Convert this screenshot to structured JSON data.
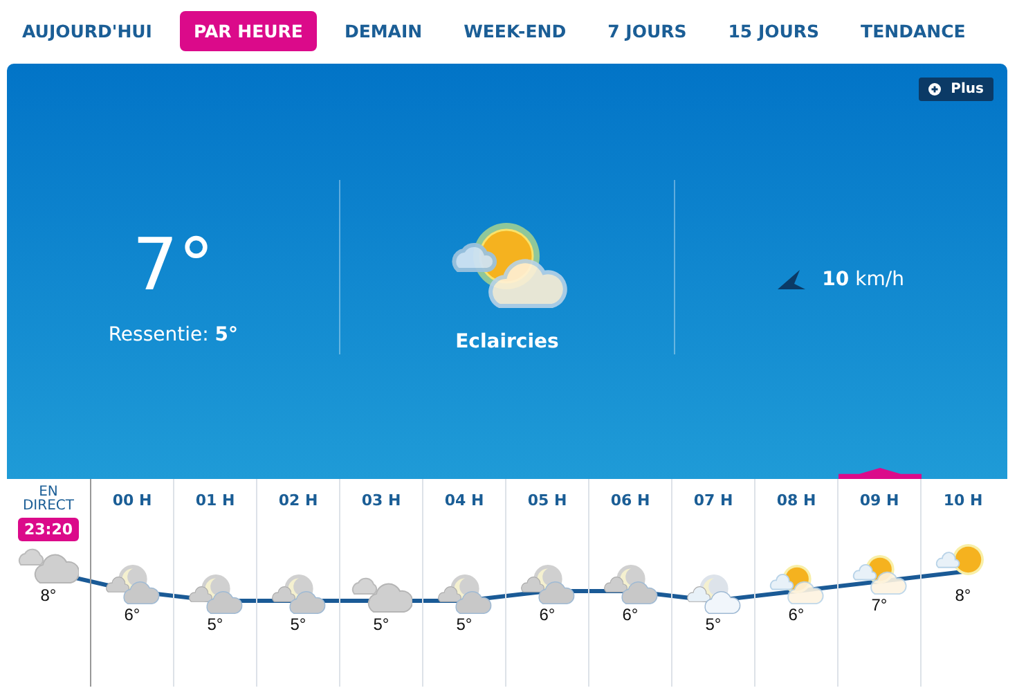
{
  "tabs": [
    {
      "label": "AUJOURD'HUI",
      "selected": false
    },
    {
      "label": "PAR HEURE",
      "selected": true
    },
    {
      "label": "DEMAIN",
      "selected": false
    },
    {
      "label": "WEEK-END",
      "selected": false
    },
    {
      "label": "7 JOURS",
      "selected": false
    },
    {
      "label": "15 JOURS",
      "selected": false
    },
    {
      "label": "TENDANCE",
      "selected": false
    }
  ],
  "more_button": {
    "label": "Plus"
  },
  "current": {
    "temperature": "7°",
    "feels_like_label": "Ressentie:",
    "feels_like": "5°",
    "condition": "Eclaircies",
    "wind_speed": "10",
    "wind_unit": "km/h"
  },
  "hours": [
    {
      "kind": "cloudy",
      "label": "EN DIRECT",
      "time": "23:20",
      "temp": "8°",
      "selected": false
    },
    {
      "kind": "night",
      "label": "00 H",
      "temp": "6°",
      "selected": false
    },
    {
      "kind": "night",
      "label": "01 H",
      "temp": "5°",
      "selected": false
    },
    {
      "kind": "night",
      "label": "02 H",
      "temp": "5°",
      "selected": false
    },
    {
      "kind": "cloudy",
      "label": "03 H",
      "temp": "5°",
      "selected": false
    },
    {
      "kind": "night",
      "label": "04 H",
      "temp": "5°",
      "selected": false
    },
    {
      "kind": "night",
      "label": "05 H",
      "temp": "6°",
      "selected": false
    },
    {
      "kind": "night",
      "label": "06 H",
      "temp": "6°",
      "selected": false
    },
    {
      "kind": "dawn",
      "label": "07 H",
      "temp": "5°",
      "selected": false
    },
    {
      "kind": "sunny-spells",
      "label": "08 H",
      "temp": "6°",
      "selected": false
    },
    {
      "kind": "sunny-spells",
      "label": "09 H",
      "temp": "7°",
      "selected": true
    },
    {
      "kind": "sunny",
      "label": "10 H",
      "temp": "8°",
      "selected": false
    }
  ]
}
